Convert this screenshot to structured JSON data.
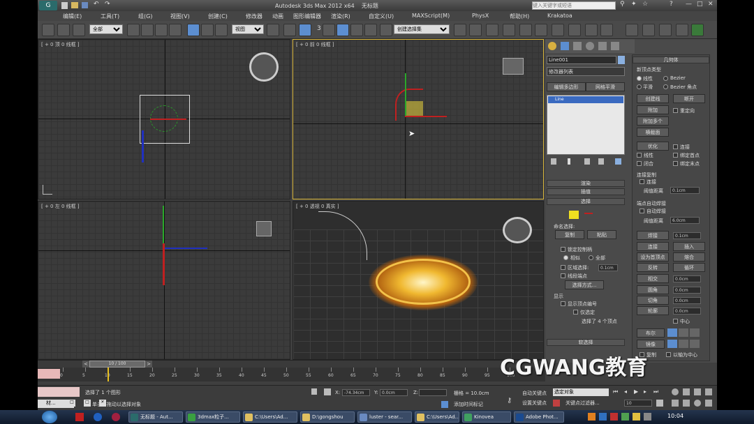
{
  "window": {
    "title": "Autodesk 3ds Max  2012 x64",
    "doc": "无标题",
    "search_placeholder": "键入关键字或短语",
    "minimize": "—",
    "maximize": "□",
    "close": "✕"
  },
  "menu": [
    "编辑(E)",
    "工具(T)",
    "组(G)",
    "视图(V)",
    "创建(C)",
    "修改器",
    "动画",
    "图形编辑器",
    "渲染(R)",
    "自定义(U)",
    "MAXScript(M)",
    "PhysX",
    "帮助(H)",
    "Krakatoa"
  ],
  "toolbar": {
    "selection_filter": "全部",
    "ref_coord": "视图",
    "named_selection": "创建选择集",
    "num_label": "3"
  },
  "viewports": {
    "top": "[ + 0 顶 0 线框 ]",
    "front": "[ + 0 前 0 线框 ]",
    "left": "[ + 0 左 0 线框 ]",
    "persp": "[ + 0 透视 0 真实 ]"
  },
  "command_panel": {
    "object_name": "Line001",
    "modifier_list": "修改器列表",
    "tab_edit_poly": "编辑多边形",
    "tab_mesh_smooth": "网格平滑",
    "stack_item": "Line",
    "rollout_render": "渲染",
    "rollout_interp": "插值",
    "rollout_select": "选择",
    "named_sel_label": "命名选择:",
    "copy": "复制",
    "paste": "粘贴",
    "lock_handles": "锁定控制柄",
    "similar": "相似",
    "all": "全部",
    "area_select": "区域选择:",
    "area_value": "0.1cm",
    "seg_end": "线段端点",
    "select_by": "选择方式...",
    "display": "显示",
    "show_vertex_numbers": "显示顶点编号",
    "only_selected": "仅选定",
    "selected_count": "选择了 4 个顶点",
    "soft_select": "软选择"
  },
  "geometry": {
    "title": "几何体",
    "new_vertex_type": "新顶点类型",
    "linear": "线性",
    "bezier": "Bezier",
    "smooth": "平滑",
    "bezier_corner": "Bezier 角点",
    "create_line": "创建线",
    "break": "断开",
    "attach": "附加",
    "reorient": "重定向",
    "attach_multi": "附加多个",
    "cross_section": "横截面",
    "refine": "优化",
    "connect": "连接",
    "linear2": "线性",
    "bind_first": "绑定首点",
    "closed": "闭合",
    "bind_last": "绑定末点",
    "connect_copy": "连接复制",
    "connect_chk": "连接",
    "threshold": "阈值距离",
    "threshold_val": "0.1cm",
    "end_weld": "端点自动焊接",
    "auto_weld": "自动焊接",
    "threshold2": "阈值距离",
    "threshold2_val": "6.0cm",
    "weld": "焊接",
    "weld_val": "0.1cm",
    "connect_btn": "连接",
    "insert": "插入",
    "make_first": "设为首顶点",
    "fuse": "熔合",
    "reverse": "反转",
    "cycle": "循环",
    "cross_insert": "相交",
    "cross_val": "0.0cm",
    "fillet": "圆角",
    "fillet_val": "0.0cm",
    "chamfer": "切角",
    "chamfer_val": "0.0cm",
    "outline": "轮廓",
    "outline_val": "0.0cm",
    "center": "中心",
    "boolean": "布尔",
    "mirror": "镜像",
    "copy": "复制",
    "about_pivot": "以轴为中心"
  },
  "timeline": {
    "frame": "10 / 100",
    "ticks": [
      "0",
      "5",
      "10",
      "15",
      "20",
      "25",
      "30",
      "35",
      "40",
      "45",
      "50",
      "55",
      "60",
      "65",
      "70",
      "75",
      "80",
      "85",
      "90",
      "95",
      "100"
    ]
  },
  "status": {
    "selected": "选择了 1 个图形",
    "prompt": "单击并拖动以选择对象",
    "x_label": "X:",
    "x_val": "-74.34cm",
    "y_label": "Y:",
    "y_val": "0.0cm",
    "z_label": "Z:",
    "z_val": "",
    "grid": "栅格 = 10.0cm",
    "add_time_tag": "添加时间标记",
    "auto_key": "自动关键点",
    "set_key": "设置关键点",
    "selected_object": "选定对象",
    "key_filters": "关键点过滤器...",
    "frame_num": "10",
    "material_tab": "材..."
  },
  "watermark": "CGWANG教育",
  "taskbar": {
    "items": [
      "无标题 - Aut...",
      "3dmax粒子...",
      "C:\\Users\\Ad...",
      "D:\\gongshou",
      "luster - sear...",
      "C:\\Users\\Ad...",
      "Kinovea",
      "Adobe Phot..."
    ],
    "time": "10:04"
  }
}
